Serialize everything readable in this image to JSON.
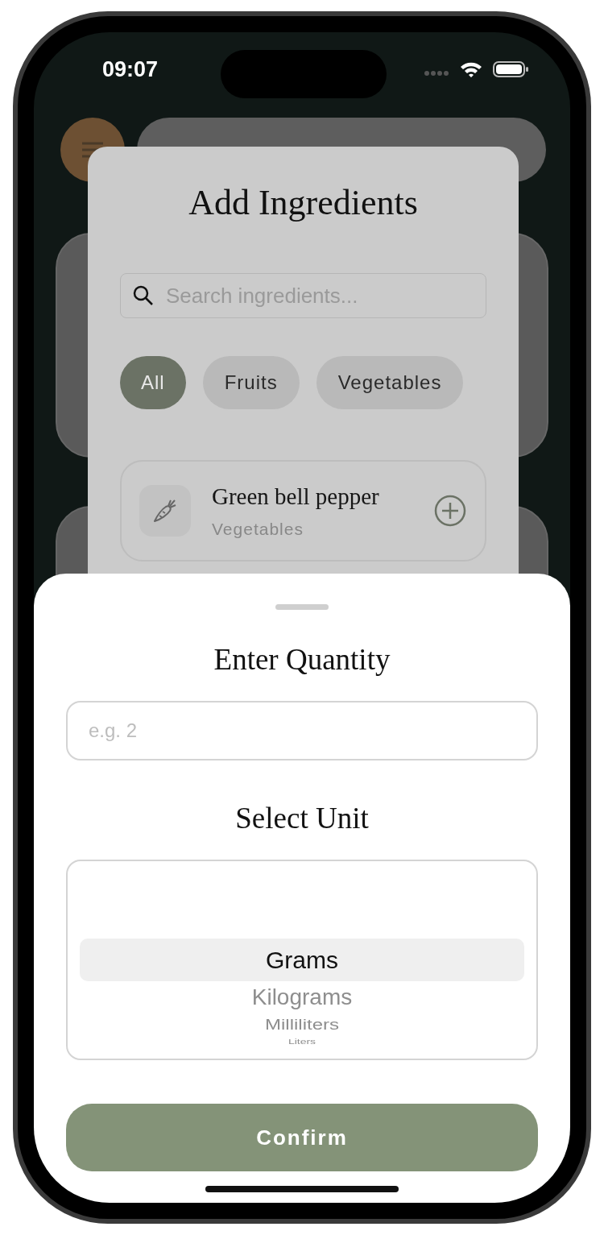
{
  "status_bar": {
    "time": "09:07"
  },
  "modal": {
    "title": "Add Ingredients",
    "search": {
      "placeholder": "Search ingredients..."
    },
    "filters": [
      {
        "label": "All",
        "selected": true
      },
      {
        "label": "Fruits",
        "selected": false
      },
      {
        "label": "Vegetables",
        "selected": false
      }
    ],
    "ingredients": [
      {
        "name": "Green bell pepper",
        "category": "Vegetables"
      }
    ]
  },
  "quantity_sheet": {
    "title": "Enter Quantity",
    "quantity": {
      "placeholder": "e.g. 2"
    },
    "unit_title": "Select Unit",
    "units": [
      {
        "label": "Grams",
        "selected": true
      },
      {
        "label": "Kilograms",
        "selected": false
      },
      {
        "label": "Milliliters",
        "selected": false
      },
      {
        "label": "Liters",
        "selected": false
      }
    ],
    "confirm": "Confirm"
  }
}
